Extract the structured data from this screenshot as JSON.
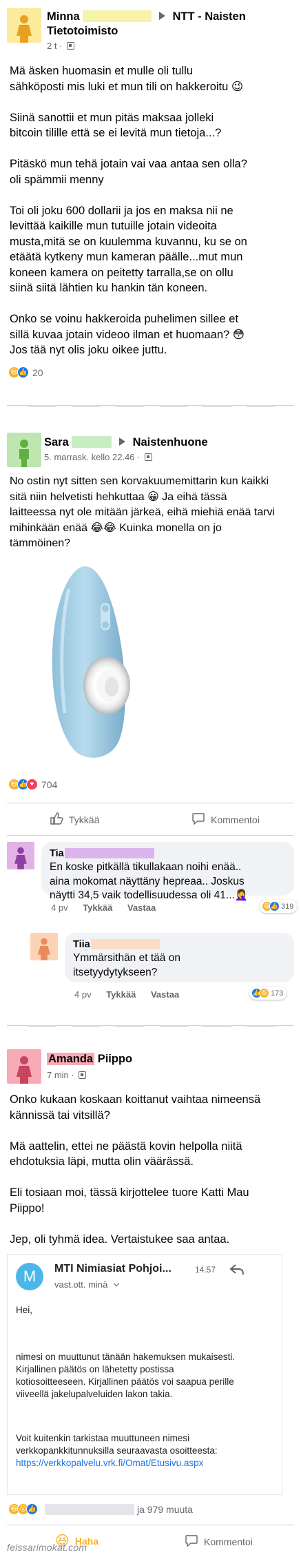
{
  "colors": {
    "accent": "#1877f2",
    "haha": "#f7b125",
    "meta_text": "#65676b",
    "avatar_orange": "#fbeb9a",
    "avatar_green": "#bfe6b1",
    "avatar_purple": "#e2b4e6",
    "avatar_peach": "#fcd2b6",
    "avatar_pink": "#f7a9b6"
  },
  "post1": {
    "author": "Minna",
    "group": "NTT - Naisten Tietotoimisto",
    "time": "2 t",
    "body": "Mä äsken huomasin et mulle oli tullu\nsähköposti mis luki et mun tili on hakkeroitu 😉\n\nSiinä sanottii et mun pitäs maksaa jolleki\nbitcoin tilille että se ei levitä mun tietoja...?\n\nPitäskö mun tehä jotain vai vaa antaa sen olla?\noli spämmii menny\n\nToi oli joku 600 dollarii ja jos en maksa nii ne\nlevittää kaikille mun tutuille jotain videoita\nmusta,mitä se on kuulemma kuvannu, ku se on\netäätä kytkeny mun kameran päälle...mut mun\nkoneen kamera on peitetty tarralla,se on ollu\nsiinä siitä lähtien ku hankin tän koneen.\n\nOnko se voinu hakkeroida puhelimen sillee et\nsillä kuvaa jotain videoo ilman et huomaan? 😳\nJos tää nyt olis joku oikee juttu.",
    "reaction_count": "20"
  },
  "post2": {
    "author": "Sara",
    "group": "Naistenhuone",
    "time": "5. marrask. kello 22.46",
    "body": "No ostin nyt sitten sen korvakuumemittarin kun kaikki\nsitä niin helvetisti hehkuttaa 😀 Ja eihä tässä\nlaitteessa nyt ole mitään järkeä, eihä miehiä enää tarvi\nmihinkään enää 😂😂 Kuinka monella on jo\ntämmöinen?",
    "reaction_count": "704",
    "like_label": "Tykkää",
    "comment_label": "Kommentoi",
    "comments": [
      {
        "name": "Tia",
        "text": "En koske pitkällä tikullakaan noihi enää..\naina mokomat näyttäny hepreaa.. Joskus\nnäytti 34,5 vaik todellisuudessa oli 41...🤦‍♀️",
        "time": "4 pv",
        "like": "Tykkää",
        "reply": "Vastaa",
        "reactions": "319"
      },
      {
        "name": "Tiia",
        "text": "Ymmärsithän et tää on\nitsetyydytykseen?",
        "time": "4 pv",
        "like": "Tykkää",
        "reply": "Vastaa",
        "reactions": "173"
      }
    ]
  },
  "post3": {
    "author_first": "Amanda",
    "author_last": "Piippo",
    "time": "7 min",
    "body": "Onko kukaan koskaan koittanut vaihtaa nimeensä\nkännissä tai vitsillä?\n\nMä aattelin, ettei ne päästä kovin helpolla niitä\nehdotuksia läpi, mutta olin väärässä.\n\nEli tosiaan moi, tässä kirjottelee tuore Katti Mau\nPiippo!\n\nJep, oli tyhmä idea. Vertaistukee saa antaa.",
    "email": {
      "avatar_letter": "M",
      "sender": "MTI Nimiasiat Pohjoi...",
      "time": "14.57",
      "to": "vast.ott. minä",
      "greeting": "Hei,",
      "body": "nimesi on muuttunut tänään hakemuksen mukaisesti.\nKirjallinen päätös on lähetetty postissa\nkotiosoitteeseen. Kirjallinen päätös voi saapua perille\nviiveellä jakelupalveluiden lakon takia.",
      "check_text": "Voit kuitenkin tarkistaa muuttuneen nimesi\nverkkopankkitunnuksilla seuraavasta osoitteesta:",
      "link": "https://verkkopalvelu.vrk.fi/Omat/Etusivu.aspx"
    },
    "reaction_suffix": "ja 979 muuta",
    "haha_label": "Haha",
    "comment_label": "Kommentoi"
  },
  "watermark": "feissarimokat.com"
}
